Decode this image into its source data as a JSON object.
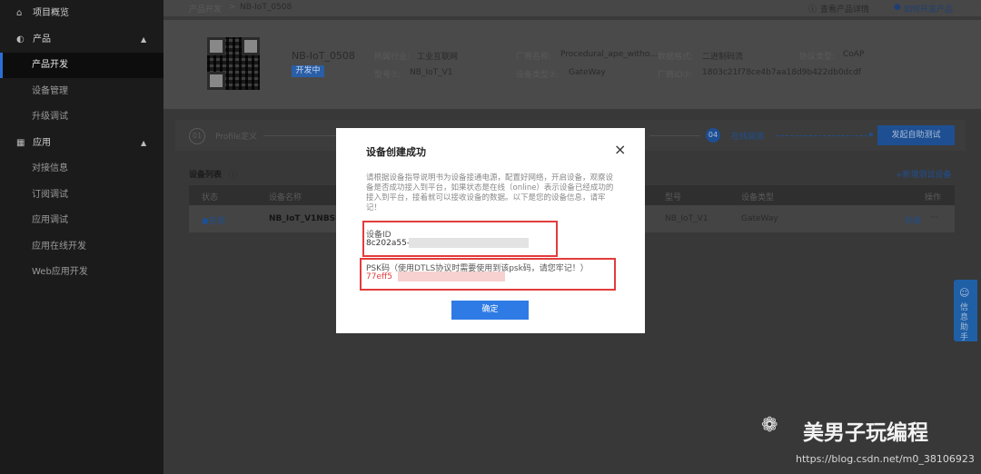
{
  "sidebar": {
    "items": [
      {
        "label": "项目概览",
        "icon": "home-icon"
      },
      {
        "label": "产品",
        "icon": "product-icon"
      },
      {
        "label": "产品开发"
      },
      {
        "label": "设备管理"
      },
      {
        "label": "升级调试"
      },
      {
        "label": "应用",
        "icon": "grid-icon"
      },
      {
        "label": "对接信息"
      },
      {
        "label": "订阅调试"
      },
      {
        "label": "应用调试"
      },
      {
        "label": "应用在线开发"
      },
      {
        "label": "Web应用开发"
      }
    ]
  },
  "header": {
    "breadcrumb_root": "产品开发",
    "breadcrumb_sep": ">",
    "breadcrumb_current": "NB-IoT_0508",
    "view_details": "查看产品详情",
    "how_to_develop": "如何开发产品"
  },
  "product": {
    "name": "NB-IoT_0508",
    "status": "开发中",
    "industry_label": "所属行业:",
    "industry_value": "工业互联网",
    "model_label": "型号⑦:",
    "model_value": "NB_IoT_V1",
    "vendor_label": "厂商名称:",
    "vendor_value": "Procedural_ape_witho...",
    "data_format_label": "数据格式:",
    "data_format_value": "二进制码流",
    "protocol_label": "协议类型:",
    "protocol_value": "CoAP",
    "device_type_label": "设备类型⑦:",
    "device_type_value": "GateWay",
    "vendor_id_label": "厂商ID⑦:",
    "vendor_id_value": "1803c21f78ce4b7aa18d9b422db0dcdf"
  },
  "steps": {
    "step1_num": "01",
    "step1_label": "Profile定义",
    "step4_num": "04",
    "step4_label": "在线调测",
    "start_button": "发起自助测试"
  },
  "device_list": {
    "title": "设备列表",
    "new_device": "+新增测试设备",
    "columns": [
      "状态",
      "设备名称",
      "型号",
      "设备类型",
      "操作"
    ],
    "row": {
      "status": "●在线",
      "name": "NB_IoT_V1NBSi",
      "model": "NB_IoT_V1",
      "type": "GateWay",
      "action": "升级",
      "more": "···"
    }
  },
  "modal": {
    "title": "设备创建成功",
    "close": "×",
    "description": "请根据设备指导说明书为设备接通电源，配置好网络，开启设备，观察设备是否成功接入到平台，如果状态是在线（online）表示设备已经成功的接入到平台，接着就可以接收设备的数据。以下是您的设备信息，请牢记！",
    "device_id_label": "设备ID",
    "device_id_value": "8c202a55-",
    "psk_label": "PSK码（使用DTLS协议时需要使用到该psk码，请您牢记！）",
    "psk_value": "77eff5",
    "ok_button": "确定"
  },
  "assistant": {
    "label": "信息助手"
  },
  "watermark": {
    "brand": "美男子玩编程",
    "url": "https://blog.csdn.net/m0_38106923"
  }
}
